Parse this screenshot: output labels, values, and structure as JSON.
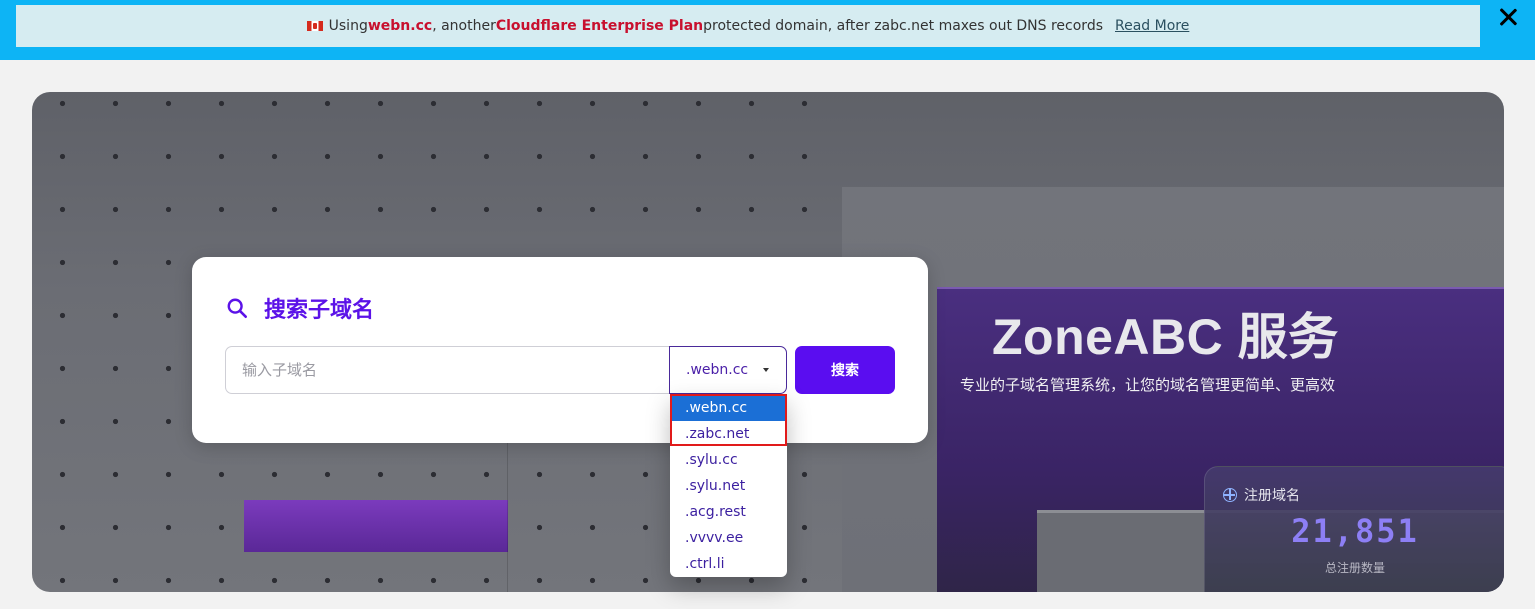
{
  "announcement": {
    "prefix": "Using ",
    "domain": "webn.cc",
    "middle": ", another ",
    "plan": "Cloudflare Enterprise Plan",
    "suffix": " protected domain, after zabc.net maxes out DNS records",
    "read_more": "Read More"
  },
  "hero": {
    "title": "ZoneABC 服务",
    "subtitle": "专业的子域名管理系统，让您的域名管理更简单、更高效"
  },
  "stats": {
    "label": "注册域名",
    "value": "21,851",
    "caption": "总注册数量"
  },
  "search": {
    "title": "搜索子域名",
    "placeholder": "输入子域名",
    "selected_suffix": ".webn.cc",
    "button_label": "搜索"
  },
  "dropdown": {
    "options": [
      ".webn.cc",
      ".zabc.net",
      ".sylu.cc",
      ".sylu.net",
      ".acg.rest",
      ".vvvv.ee",
      ".ctrl.li"
    ],
    "selected_index": 0
  },
  "colors": {
    "topbar": "#0db4f5",
    "accent": "#5a0df0",
    "highlight": "#c8102e",
    "selected_option": "#1b6fd6",
    "annotation_box": "#e11a1a"
  }
}
